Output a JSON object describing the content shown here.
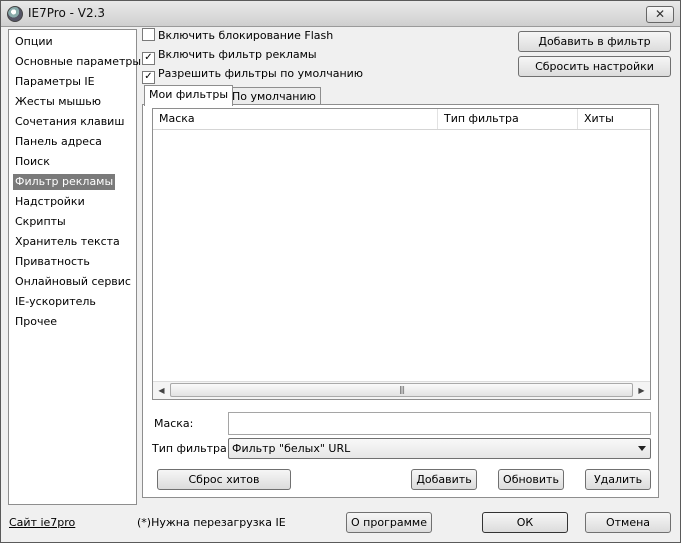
{
  "window": {
    "title": "IE7Pro - V2.3",
    "close_glyph": "✕"
  },
  "sidebar": {
    "items": [
      {
        "label": "Опции"
      },
      {
        "label": "Основные параметры"
      },
      {
        "label": "Параметры IE"
      },
      {
        "label": "Жесты мышью"
      },
      {
        "label": "Сочетания клавиш"
      },
      {
        "label": "Панель адреса"
      },
      {
        "label": "Поиск"
      },
      {
        "label": "Фильтр рекламы",
        "selected": true
      },
      {
        "label": "Надстройки"
      },
      {
        "label": "Скрипты"
      },
      {
        "label": "Хранитель текста"
      },
      {
        "label": "Приватность"
      },
      {
        "label": "Онлайновый сервис"
      },
      {
        "label": "IE-ускоритель"
      },
      {
        "label": "Прочее"
      }
    ]
  },
  "options": {
    "flash": {
      "label": "Включить блокирование Flash",
      "checked": false
    },
    "ads": {
      "label": "Включить фильтр рекламы",
      "checked": true
    },
    "defaults": {
      "label": "Разрешить фильтры по умолчанию",
      "checked": true
    }
  },
  "buttons": {
    "add_to_filter": "Добавить в фильтр",
    "reset_settings": "Сбросить настройки",
    "reset_hits": "Сброс хитов",
    "add": "Добавить",
    "update": "Обновить",
    "delete": "Удалить",
    "about": "О программе",
    "ok": "ОК",
    "cancel": "Отмена"
  },
  "tabs": {
    "my_filters": "Мои фильтры",
    "default": "По умолчанию"
  },
  "table": {
    "columns": [
      "Маска",
      "Тип фильтра",
      "Хиты"
    ],
    "rows": []
  },
  "scroll": {
    "left": "◀",
    "right": "▶",
    "thumb": "|||"
  },
  "form": {
    "mask_label": "Маска:",
    "mask_value": "",
    "type_label": "Тип фильтра:",
    "type_value": "Фильтр \"белых\" URL"
  },
  "footer": {
    "site_link": "Сайт ie7pro",
    "note": "(*)Нужна перезагрузка IE"
  },
  "check_glyph": "✓"
}
